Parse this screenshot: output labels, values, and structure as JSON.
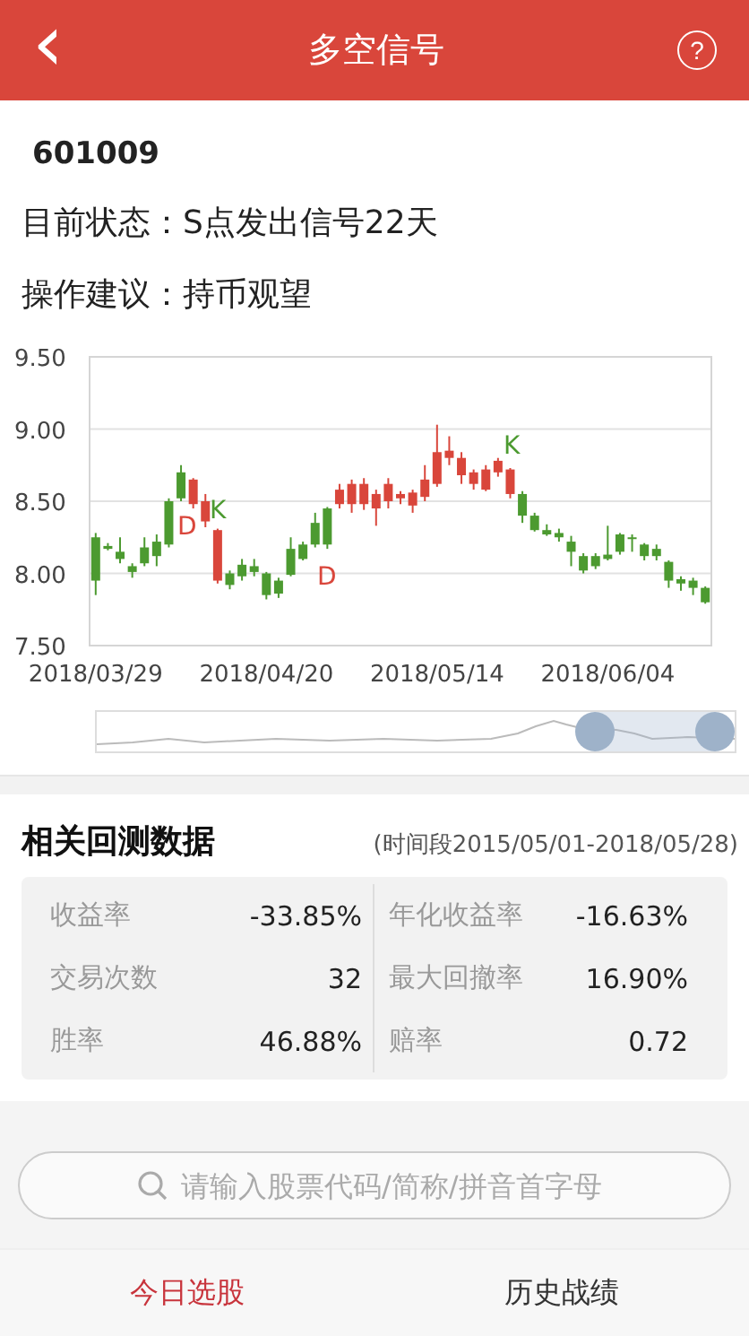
{
  "header": {
    "title": "多空信号",
    "back": "‹",
    "help": "?"
  },
  "stock": {
    "code": "601009",
    "status": "目前状态：S点发出信号22天",
    "advice": "操作建议：持币观望"
  },
  "price_chart": {
    "signals": [
      {
        "text": "D",
        "kind": "buy"
      },
      {
        "text": "K",
        "kind": "sell"
      },
      {
        "text": "D",
        "kind": "buy"
      },
      {
        "text": "K",
        "kind": "sell"
      }
    ],
    "chart_data": {
      "type": "candlestick",
      "ylim": [
        7.5,
        9.5
      ],
      "grid": true,
      "yticks": [
        {
          "value": 9.5,
          "label": "9.50"
        },
        {
          "value": 9,
          "label": "9.00"
        },
        {
          "value": 8.5,
          "label": "8.50"
        },
        {
          "value": 8,
          "label": "8.00"
        },
        {
          "value": 7.5,
          "label": "7.50"
        }
      ],
      "categories": [
        "2018/03/29",
        null,
        null,
        null,
        null,
        null,
        null,
        null,
        null,
        null,
        null,
        null,
        null,
        null,
        "2018/04/20",
        null,
        null,
        null,
        null,
        null,
        null,
        null,
        null,
        null,
        null,
        null,
        null,
        null,
        "2018/05/14",
        null,
        null,
        null,
        null,
        null,
        null,
        null,
        null,
        null,
        null,
        null,
        null,
        null,
        "2018/06/04",
        null,
        null,
        null,
        null,
        null,
        null,
        null,
        null
      ],
      "ohlc": [
        [
          8.25,
          8.28,
          7.85,
          7.95
        ],
        [
          8.19,
          8.21,
          8.16,
          8.17
        ],
        [
          8.15,
          8.25,
          8.07,
          8.1
        ],
        [
          8.05,
          8.07,
          7.97,
          8.01
        ],
        [
          8.18,
          8.25,
          8.05,
          8.07
        ],
        [
          8.22,
          8.27,
          8.05,
          8.12
        ],
        [
          8.5,
          8.52,
          8.18,
          8.2
        ],
        [
          8.7,
          8.75,
          8.5,
          8.52
        ],
        [
          8.48,
          8.66,
          8.45,
          8.65
        ],
        [
          8.36,
          8.55,
          8.32,
          8.5
        ],
        [
          7.95,
          8.31,
          7.93,
          8.3
        ],
        [
          8,
          8.02,
          7.89,
          7.92
        ],
        [
          8.06,
          8.1,
          7.95,
          7.98
        ],
        [
          8.05,
          8.1,
          7.98,
          8.01
        ],
        [
          8,
          8.01,
          7.82,
          7.85
        ],
        [
          7.95,
          7.97,
          7.83,
          7.86
        ],
        [
          8.17,
          8.25,
          7.98,
          7.99
        ],
        [
          8.2,
          8.22,
          8.09,
          8.1
        ],
        [
          8.35,
          8.42,
          8.18,
          8.2
        ],
        [
          8.45,
          8.46,
          8.17,
          8.2
        ],
        [
          8.48,
          8.62,
          8.45,
          8.58
        ],
        [
          8.48,
          8.65,
          8.42,
          8.62
        ],
        [
          8.48,
          8.66,
          8.44,
          8.62
        ],
        [
          8.45,
          8.58,
          8.33,
          8.55
        ],
        [
          8.5,
          8.66,
          8.45,
          8.62
        ],
        [
          8.52,
          8.57,
          8.48,
          8.55
        ],
        [
          8.47,
          8.58,
          8.42,
          8.56
        ],
        [
          8.53,
          8.75,
          8.5,
          8.65
        ],
        [
          8.62,
          9.03,
          8.6,
          8.84
        ],
        [
          8.8,
          8.95,
          8.75,
          8.85
        ],
        [
          8.68,
          8.84,
          8.62,
          8.8
        ],
        [
          8.62,
          8.72,
          8.58,
          8.7
        ],
        [
          8.58,
          8.75,
          8.57,
          8.72
        ],
        [
          8.7,
          8.8,
          8.67,
          8.78
        ],
        [
          8.55,
          8.73,
          8.52,
          8.72
        ],
        [
          8.55,
          8.57,
          8.35,
          8.4
        ],
        [
          8.4,
          8.42,
          8.29,
          8.3
        ],
        [
          8.3,
          8.34,
          8.26,
          8.27
        ],
        [
          8.28,
          8.31,
          8.22,
          8.25
        ],
        [
          8.22,
          8.26,
          8.05,
          8.15
        ],
        [
          8.12,
          8.14,
          8,
          8.02
        ],
        [
          8.12,
          8.14,
          8.03,
          8.05
        ],
        [
          8.13,
          8.33,
          8.09,
          8.1
        ],
        [
          8.27,
          8.28,
          8.13,
          8.15
        ],
        [
          8.25,
          8.27,
          8.15,
          8.24
        ],
        [
          8.2,
          8.21,
          8.09,
          8.12
        ],
        [
          8.17,
          8.2,
          8.09,
          8.12
        ],
        [
          8.08,
          8.09,
          7.9,
          7.95
        ],
        [
          7.96,
          7.98,
          7.88,
          7.93
        ],
        [
          7.95,
          7.97,
          7.85,
          7.9
        ],
        [
          7.9,
          7.91,
          7.79,
          7.8
        ]
      ]
    }
  },
  "zoom_slider": {
    "handles": [
      {
        "level": 0.78
      },
      {
        "level": 0.97
      }
    ]
  },
  "backtest": {
    "title": "相关回测数据",
    "period": "(时间段2015/05/01-2018/05/28)",
    "stats": [
      {
        "label": "收益率",
        "value": "-33.85%"
      },
      {
        "label": "年化收益率",
        "value": "-16.63%"
      },
      {
        "label": "交易次数",
        "value": "32"
      },
      {
        "label": "最大回撤率",
        "value": "16.90%"
      },
      {
        "label": "胜率",
        "value": "46.88%"
      },
      {
        "label": "赔率",
        "value": "0.72"
      }
    ]
  },
  "search": {
    "placeholder": "请输入股票代码/简称/拼音首字母"
  },
  "tabs": [
    {
      "label": "今日选股",
      "selected": true
    },
    {
      "label": "历史战绩",
      "selected": false
    }
  ]
}
